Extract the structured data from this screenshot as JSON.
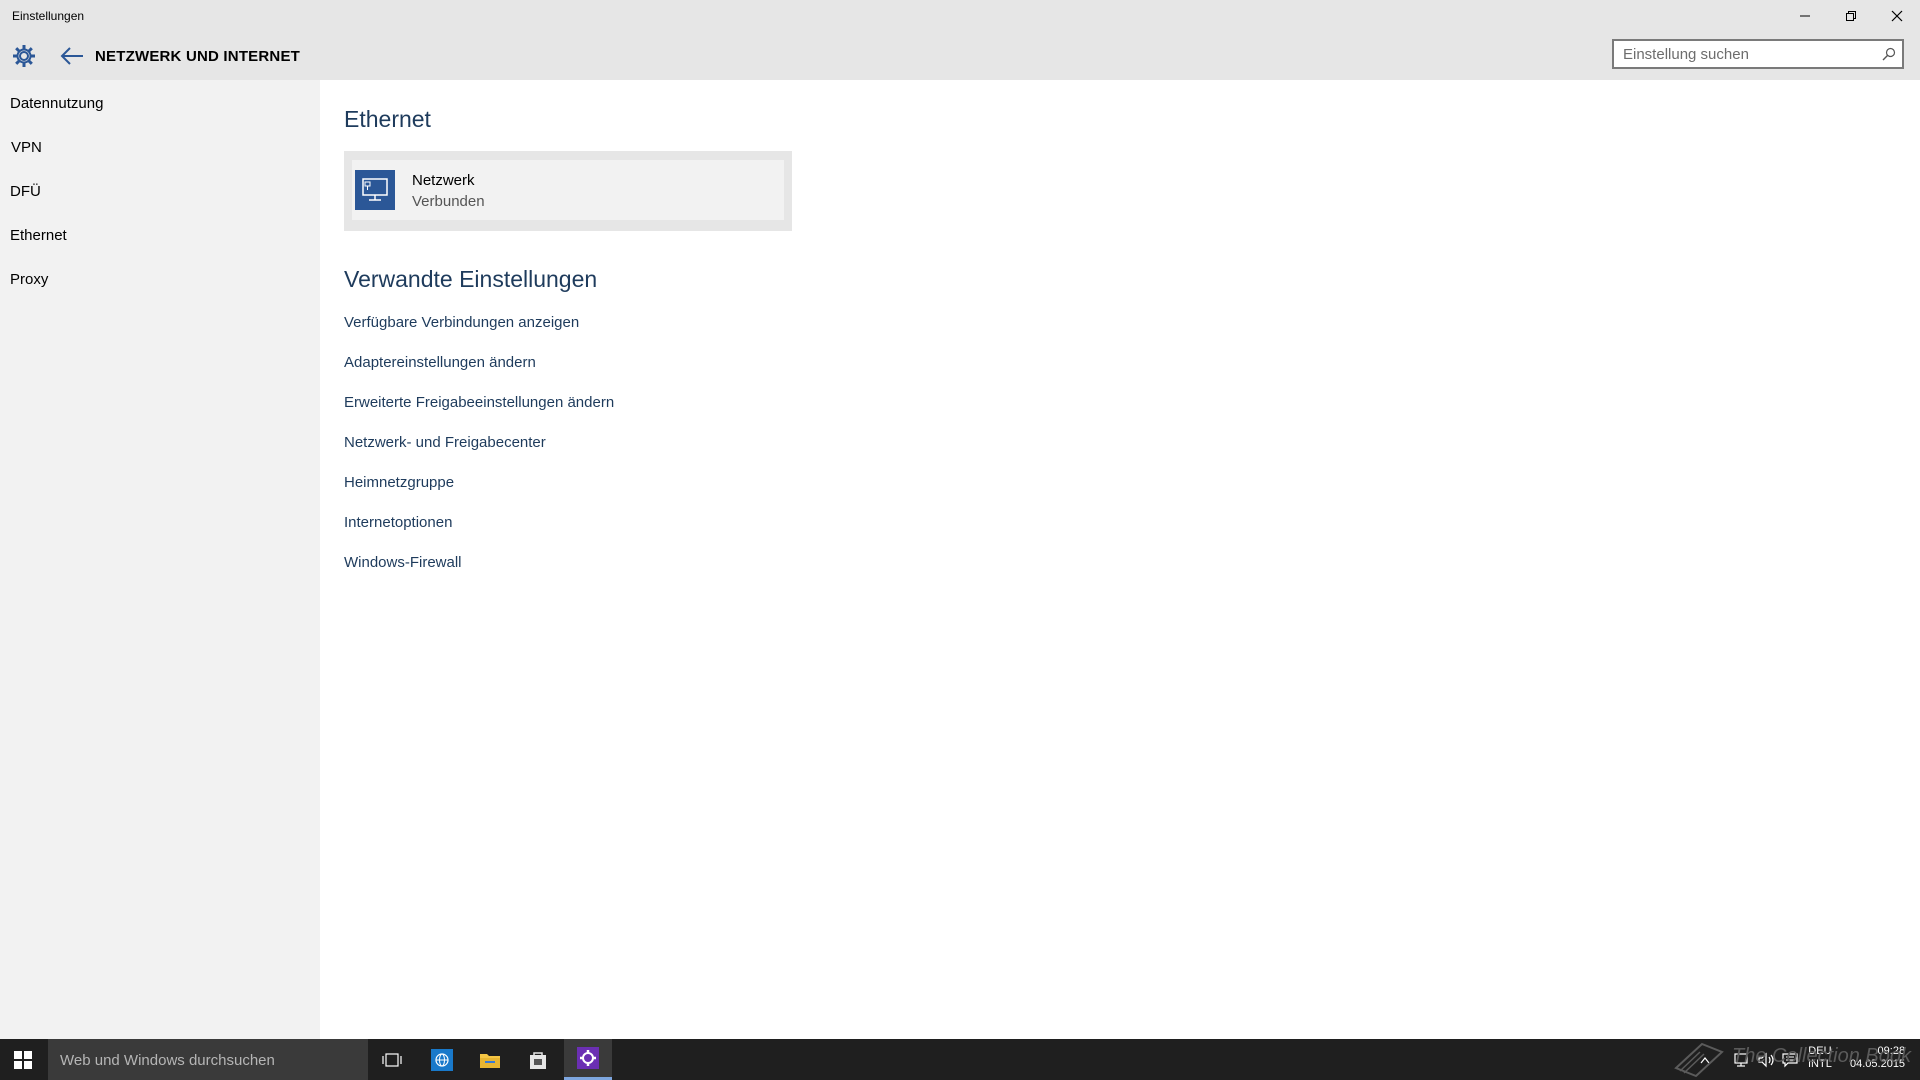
{
  "window": {
    "title": "Einstellungen",
    "controls": {
      "minimize": "minimize-icon",
      "maximize": "restore-icon",
      "close": "close-icon"
    }
  },
  "header": {
    "title": "NETZWERK UND INTERNET",
    "search_placeholder": "Einstellung suchen"
  },
  "sidebar": {
    "items": [
      {
        "label": "Datennutzung"
      },
      {
        "label": "VPN"
      },
      {
        "label": "DFÜ"
      },
      {
        "label": "Ethernet"
      },
      {
        "label": "Proxy"
      }
    ]
  },
  "main": {
    "section_title": "Ethernet",
    "network": {
      "name": "Netzwerk",
      "status": "Verbunden"
    },
    "related_title": "Verwandte Einstellungen",
    "links": [
      "Verfügbare Verbindungen anzeigen",
      "Adaptereinstellungen ändern",
      "Erweiterte Freigabeeinstellungen ändern",
      "Netzwerk- und Freigabecenter",
      "Heimnetzgruppe",
      "Internetoptionen",
      "Windows-Firewall"
    ]
  },
  "taskbar": {
    "search_placeholder": "Web und Windows durchsuchen",
    "language": {
      "line1": "DEU",
      "line2": "INTL"
    },
    "time": "09:28",
    "date": "04.05.2015",
    "watermark": "The Collection Book"
  },
  "colors": {
    "accent": "#2b5797",
    "link": "#1e3b5c",
    "chrome": "#e6e6e6",
    "sidebar": "#f2f2f2",
    "taskbar": "#1f1f1f"
  }
}
